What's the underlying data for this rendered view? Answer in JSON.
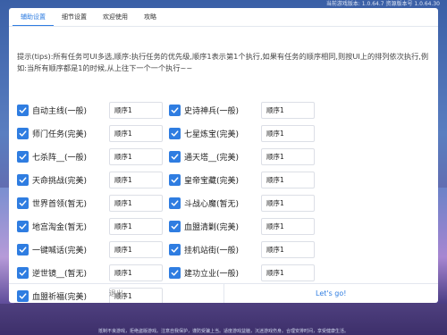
{
  "window": {
    "version_text": "当前游戏版本: 1.0.64.7 资源版本号 1.0.64.30"
  },
  "tabs": [
    {
      "label": "辅助设置",
      "active": true
    },
    {
      "label": "细节设置",
      "active": false
    },
    {
      "label": "欢迎使用",
      "active": false
    },
    {
      "label": "攻略",
      "active": false
    }
  ],
  "tip": "提示(tips):所有任务可UI多选,顺序:执行任务的优先级,顺序1表示第1个执行,如果有任务的顺序相同,则按UI上的排列依次执行,例如:当所有顺序都是1的时候,从上往下一个一个执行~~",
  "tasks": [
    {
      "label": "自动主线(一般)",
      "order": "顺序1",
      "checked": true
    },
    {
      "label": "史诗神兵(一般)",
      "order": "顺序1",
      "checked": true
    },
    {
      "label": "师门任务(完美)",
      "order": "顺序1",
      "checked": true
    },
    {
      "label": "七星炼宝(完美)",
      "order": "顺序1",
      "checked": true
    },
    {
      "label": "七杀阵__(一般)",
      "order": "顺序1",
      "checked": true
    },
    {
      "label": "通天塔__(完美)",
      "order": "顺序1",
      "checked": true
    },
    {
      "label": "天命挑战(完美)",
      "order": "顺序1",
      "checked": true
    },
    {
      "label": "皇帝宝藏(完美)",
      "order": "顺序1",
      "checked": true
    },
    {
      "label": "世界首领(暂无)",
      "order": "顺序1",
      "checked": true
    },
    {
      "label": "斗战心魔(暂无)",
      "order": "顺序1",
      "checked": true
    },
    {
      "label": "地宫淘金(暂无)",
      "order": "顺序1",
      "checked": true
    },
    {
      "label": "血盟清剿(完美)",
      "order": "顺序1",
      "checked": true
    },
    {
      "label": "一键喊话(完美)",
      "order": "顺序1",
      "checked": true
    },
    {
      "label": "挂机站街(一般)",
      "order": "顺序1",
      "checked": true
    },
    {
      "label": "逆世镜__(暂无)",
      "order": "顺序1",
      "checked": true
    },
    {
      "label": "建功立业(一般)",
      "order": "顺序1",
      "checked": true
    },
    {
      "label": "血盟祈福(完美)",
      "order": "顺序1",
      "checked": true
    }
  ],
  "buttons": {
    "exit": "退出",
    "go": "Let's go!"
  },
  "footer": "抵制不良游戏，拒绝盗版游戏。注意自我保护，谨防受骗上当。适度游戏益脑，沉迷游戏伤身。合理安排时间，享受健康生活。",
  "colors": {
    "accent": "#2f7de1"
  }
}
